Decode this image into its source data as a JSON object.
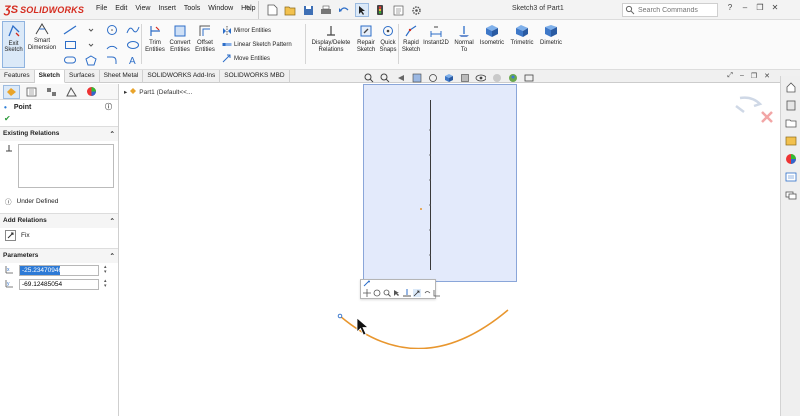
{
  "app": {
    "brand": "SOLIDWORKS",
    "document_title": "Sketch3 of Part1"
  },
  "menu": [
    "File",
    "Edit",
    "View",
    "Insert",
    "Tools",
    "Window",
    "Help"
  ],
  "search": {
    "placeholder": "Search Commands"
  },
  "commands": {
    "exit_sketch": "Exit Sketch",
    "smart_dimension": "Smart Dimension",
    "trim_entities": "Trim Entities",
    "convert_entities": "Convert Entities",
    "offset_entities": "Offset Entities",
    "mirror_entities": "Mirror Entities",
    "linear_sketch_pattern": "Linear Sketch Pattern",
    "move_entities": "Move Entities",
    "display_delete_relations": "Display/Delete Relations",
    "repair_sketch": "Repair Sketch",
    "quick_snaps": "Quick Snaps",
    "rapid_sketch": "Rapid Sketch",
    "instant2d": "Instant2D",
    "normal_to": "Normal To",
    "isometric": "Isometric",
    "trimetric": "Trimetric",
    "dimetric": "Dimetric"
  },
  "tabs": [
    "Features",
    "Sketch",
    "Surfaces",
    "Sheet Metal",
    "SOLIDWORKS Add-Ins",
    "SOLIDWORKS MBD"
  ],
  "active_tab": "Sketch",
  "property_manager": {
    "title": "Point",
    "existing_relations_title": "Existing Relations",
    "status": "Under Defined",
    "add_relations_title": "Add Relations",
    "fix_label": "Fix",
    "parameters_title": "Parameters",
    "x_value": "-25.23470946",
    "y_value": "-69.12485054"
  },
  "feature_tree": {
    "root": "Part1 (Default<<..."
  },
  "colors": {
    "brand_red": "#d52b1e",
    "plane_fill": "#e3eafb",
    "plane_border": "#8aa6d9",
    "arc": "#e8962e",
    "selection": "#2d7ad6"
  }
}
